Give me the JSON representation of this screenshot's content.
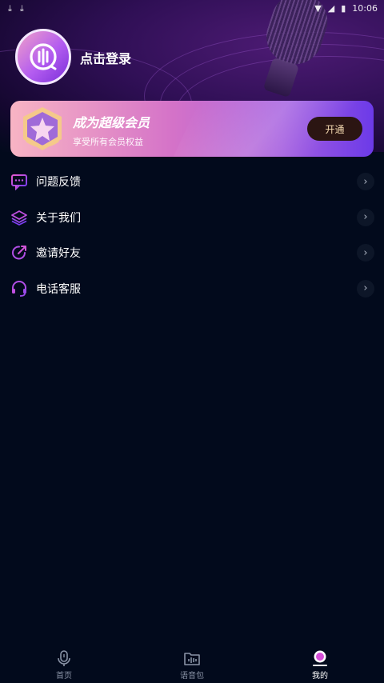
{
  "status_bar": {
    "time": "10:06"
  },
  "profile": {
    "login_label": "点击登录"
  },
  "vip": {
    "title": "成为超级会员",
    "subtitle": "享受所有会员权益",
    "button_label": "开通"
  },
  "menu": {
    "items": [
      {
        "label": "问题反馈",
        "icon": "feedback-icon"
      },
      {
        "label": "关于我们",
        "icon": "layers-icon"
      },
      {
        "label": "邀请好友",
        "icon": "share-icon"
      },
      {
        "label": "电话客服",
        "icon": "headset-icon"
      }
    ]
  },
  "tabbar": {
    "tabs": [
      {
        "label": "首页",
        "icon": "mic-icon",
        "active": false
      },
      {
        "label": "语音包",
        "icon": "voice-pack-icon",
        "active": false
      },
      {
        "label": "我的",
        "icon": "profile-icon",
        "active": true
      }
    ]
  },
  "colors": {
    "background": "#020a1c",
    "accent_purple": "#a55fe0",
    "vip_button_text": "#f4d9b0"
  }
}
